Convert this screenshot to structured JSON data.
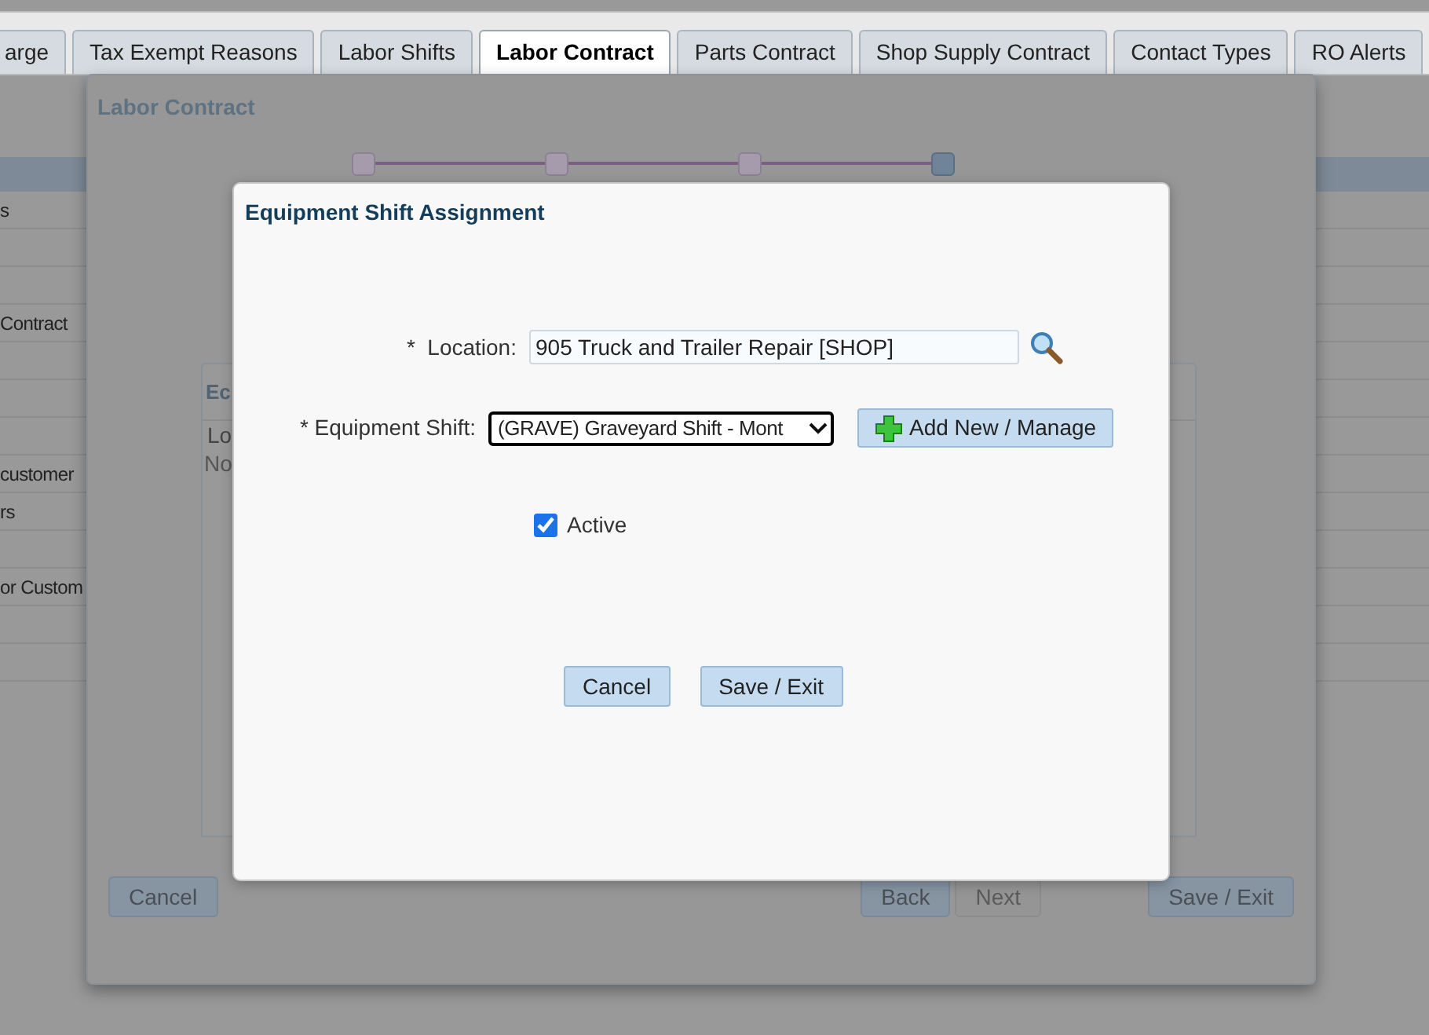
{
  "tabs": [
    {
      "label": "arge",
      "selected": false
    },
    {
      "label": "Tax Exempt Reasons",
      "selected": false
    },
    {
      "label": "Labor Shifts",
      "selected": false
    },
    {
      "label": "Labor Contract",
      "selected": true
    },
    {
      "label": "Parts Contract",
      "selected": false
    },
    {
      "label": "Shop Supply Contract",
      "selected": false
    },
    {
      "label": "Contact Types",
      "selected": false
    },
    {
      "label": "RO Alerts",
      "selected": false
    }
  ],
  "list_rows": [
    {
      "text": "s"
    },
    {},
    {},
    {
      "text": "Contract"
    },
    {},
    {},
    {},
    {
      "text": "customer"
    },
    {
      "text": "rs"
    },
    {},
    {
      "text": "or Custom"
    },
    {},
    {}
  ],
  "wizard": {
    "title": "Labor Contract",
    "steps": [
      {
        "selected": false
      },
      {
        "selected": false
      },
      {
        "selected": false
      },
      {
        "selected": true
      }
    ],
    "inner_panel": {
      "title": "Ec",
      "column_1": "Lo",
      "row_1": "No"
    },
    "buttons": [
      {
        "label": "Cancel",
        "disabled": false,
        "kind": "left"
      },
      {
        "label": "Back",
        "disabled": false,
        "kind": "right"
      },
      {
        "label": "Next",
        "disabled": true,
        "kind": "right"
      },
      {
        "label": "Save / Exit",
        "disabled": false,
        "kind": "end"
      }
    ]
  },
  "dialog": {
    "title": "Equipment Shift Assignment",
    "location": {
      "label": "*  Location:",
      "value": "905 Truck and Trailer Repair [SHOP]"
    },
    "equipment_shift": {
      "label": "* Equipment Shift:",
      "value": "(GRAVE) Graveyard Shift - Mont"
    },
    "add_button": "Add New / Manage",
    "active": {
      "label": "Active",
      "checked": true
    },
    "buttons": [
      "Cancel",
      "Save / Exit"
    ]
  }
}
